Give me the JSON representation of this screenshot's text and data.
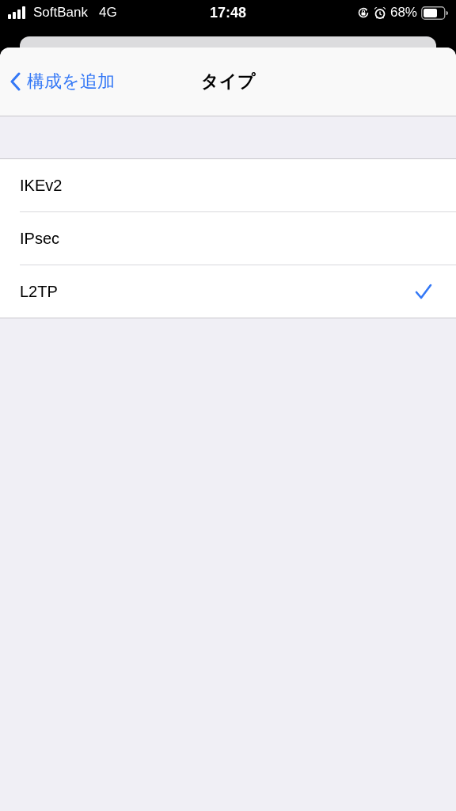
{
  "status_bar": {
    "carrier": "SoftBank",
    "network": "4G",
    "time": "17:48",
    "battery": "68%"
  },
  "nav_bar": {
    "back": "構成を追加",
    "title": "タイプ"
  },
  "options": [
    {
      "label": "IKEv2",
      "selected": false
    },
    {
      "label": "IPsec",
      "selected": false
    },
    {
      "label": "L2TP",
      "selected": true
    }
  ]
}
